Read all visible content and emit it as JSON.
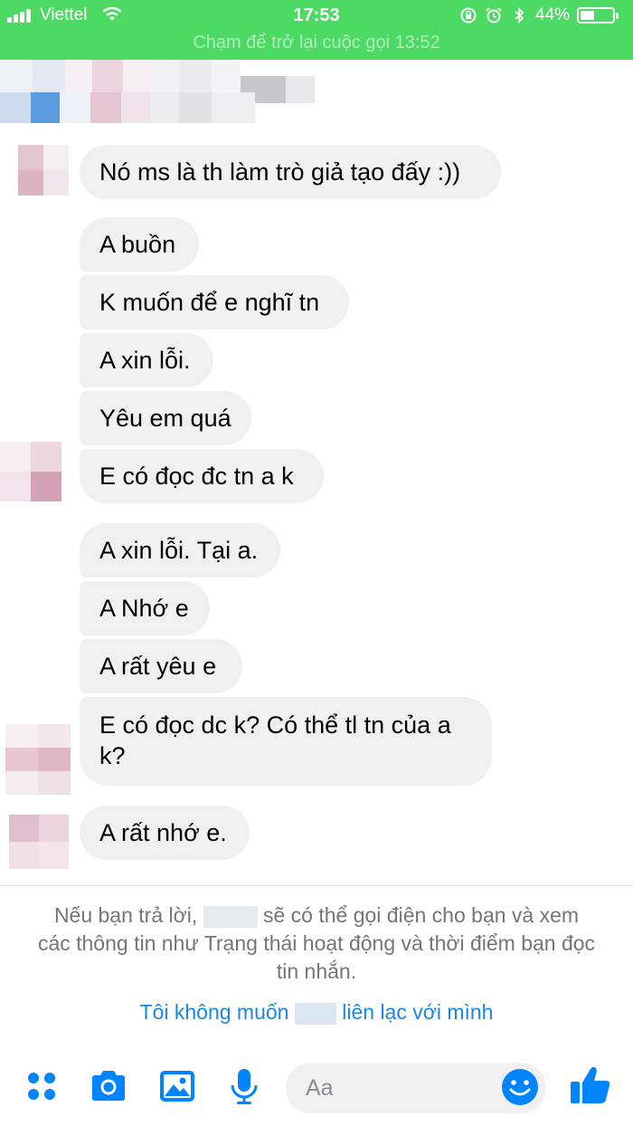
{
  "status_bar": {
    "carrier": "Viettel",
    "time": "17:53",
    "battery_text": "44%",
    "battery_level": 0.44,
    "call_banner": "Chạm để trở lại cuộc gọi 13:52"
  },
  "messages": [
    {
      "text": "Nó ms là th làm trò giả tạo đấy :))",
      "sender": "other"
    },
    {
      "text": "A buồn",
      "sender": "other"
    },
    {
      "text": "K muốn để e nghĩ tn",
      "sender": "other"
    },
    {
      "text": "A xin lỗi.",
      "sender": "other"
    },
    {
      "text": "Yêu em quá",
      "sender": "other"
    },
    {
      "text": "E có đọc đc tn a k",
      "sender": "other"
    },
    {
      "text": "A xin lỗi. Tại a.",
      "sender": "other"
    },
    {
      "text": "A Nhớ e",
      "sender": "other"
    },
    {
      "text": "A rất yêu e",
      "sender": "other"
    },
    {
      "text": "E có đọc dc k? Có thể tl tn của a k?",
      "sender": "other"
    },
    {
      "text": "A rất nhớ e.",
      "sender": "other"
    }
  ],
  "notice": {
    "part1": "Nếu bạn trả lời,",
    "part2": "sẽ có thể gọi điện cho bạn và xem các thông tin như Trạng thái hoạt động và thời điểm bạn đọc tin nhắn.",
    "link_part1": "Tôi không muốn",
    "link_part2": "liên lạc với mình"
  },
  "composer": {
    "placeholder": "Aa",
    "icons": [
      "more-icon",
      "camera-icon",
      "image-icon",
      "microphone-icon",
      "emoji-icon",
      "thumbs-up-icon"
    ]
  },
  "colors": {
    "status_bar": "#4cd964",
    "bubble": "#f1f0f0",
    "accent": "#0084ff",
    "link": "#1a86e8"
  }
}
